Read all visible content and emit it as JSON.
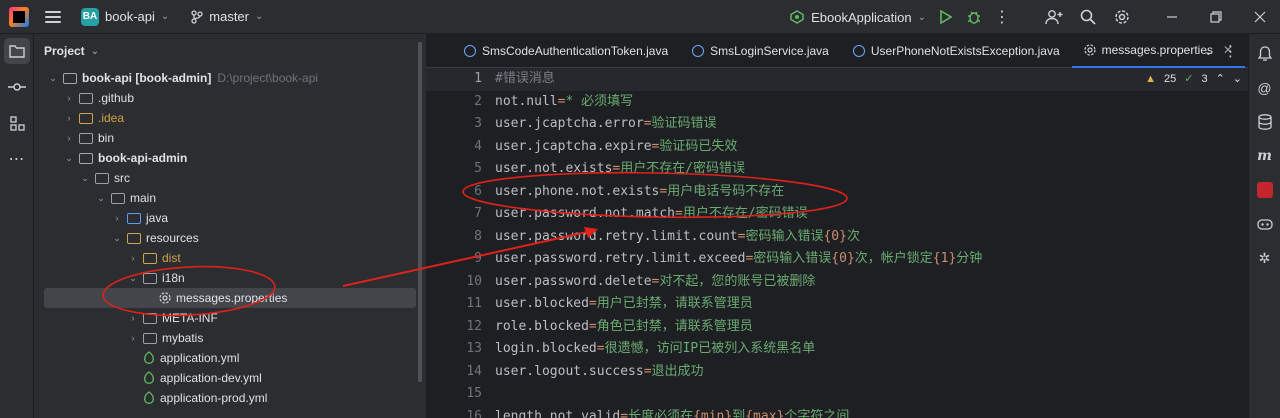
{
  "titlebar": {
    "project_badge": "BA",
    "project_name": "book-api",
    "branch": "master",
    "run_config": "EbookApplication"
  },
  "project_panel": {
    "title": "Project",
    "tree": [
      {
        "label": "book-api [book-admin]",
        "path": "D:\\project\\book-api",
        "depth": 0,
        "expanded": true,
        "kind": "module"
      },
      {
        "label": ".github",
        "depth": 1,
        "expanded": false,
        "kind": "folder"
      },
      {
        "label": ".idea",
        "depth": 1,
        "expanded": false,
        "kind": "folder",
        "color": "#cfa44a"
      },
      {
        "label": "bin",
        "depth": 1,
        "expanded": false,
        "kind": "folder"
      },
      {
        "label": "book-api-admin",
        "depth": 1,
        "expanded": true,
        "kind": "module"
      },
      {
        "label": "src",
        "depth": 2,
        "expanded": true,
        "kind": "folder"
      },
      {
        "label": "main",
        "depth": 3,
        "expanded": true,
        "kind": "folder"
      },
      {
        "label": "java",
        "depth": 4,
        "expanded": false,
        "kind": "src"
      },
      {
        "label": "resources",
        "depth": 4,
        "expanded": true,
        "kind": "res"
      },
      {
        "label": "dist",
        "depth": 5,
        "expanded": false,
        "kind": "folder",
        "color": "#cfa44a"
      },
      {
        "label": "i18n",
        "depth": 5,
        "expanded": true,
        "kind": "folder"
      },
      {
        "label": "messages.properties",
        "depth": 6,
        "kind": "file",
        "selected": true
      },
      {
        "label": "META-INF",
        "depth": 5,
        "expanded": false,
        "kind": "folder"
      },
      {
        "label": "mybatis",
        "depth": 5,
        "expanded": false,
        "kind": "folder"
      },
      {
        "label": "application.yml",
        "depth": 5,
        "kind": "yml"
      },
      {
        "label": "application-dev.yml",
        "depth": 5,
        "kind": "yml"
      },
      {
        "label": "application-prod.yml",
        "depth": 5,
        "kind": "yml"
      }
    ]
  },
  "editor": {
    "tabs": [
      {
        "label": "SmsCodeAuthenticationToken.java",
        "active": false
      },
      {
        "label": "SmsLoginService.java",
        "active": false
      },
      {
        "label": "UserPhoneNotExistsException.java",
        "active": false
      },
      {
        "label": "messages.properties",
        "active": true
      }
    ],
    "warnings": "25",
    "checks": "3",
    "line_numbers": [
      "1",
      "2",
      "3",
      "4",
      "5",
      "6",
      "7",
      "8",
      "9",
      "10",
      "11",
      "12",
      "13",
      "14",
      "15",
      "16"
    ],
    "lines": [
      "#错误消息",
      "not.null=* 必须填写",
      "user.jcaptcha.error=验证码错误",
      "user.jcaptcha.expire=验证码已失效",
      "user.not.exists=用户不存在/密码错误",
      "user.phone.not.exists=用户电话号码不存在",
      "user.password.not.match=用户不存在/密码错误",
      "user.password.retry.limit.count=密码输入错误{0}次",
      "user.password.retry.limit.exceed=密码输入错误{0}次，帐户锁定{1}分钟",
      "user.password.delete=对不起，您的账号已被删除",
      "user.blocked=用户已封禁，请联系管理员",
      "role.blocked=角色已封禁，请联系管理员",
      "login.blocked=很遗憾，访问IP已被列入系统黑名单",
      "user.logout.success=退出成功",
      "",
      "length.not.valid=长度必须在{min}到{max}个字符之间"
    ]
  },
  "colors": {
    "annotation": "#e0221b",
    "accent": "#3574f0"
  }
}
